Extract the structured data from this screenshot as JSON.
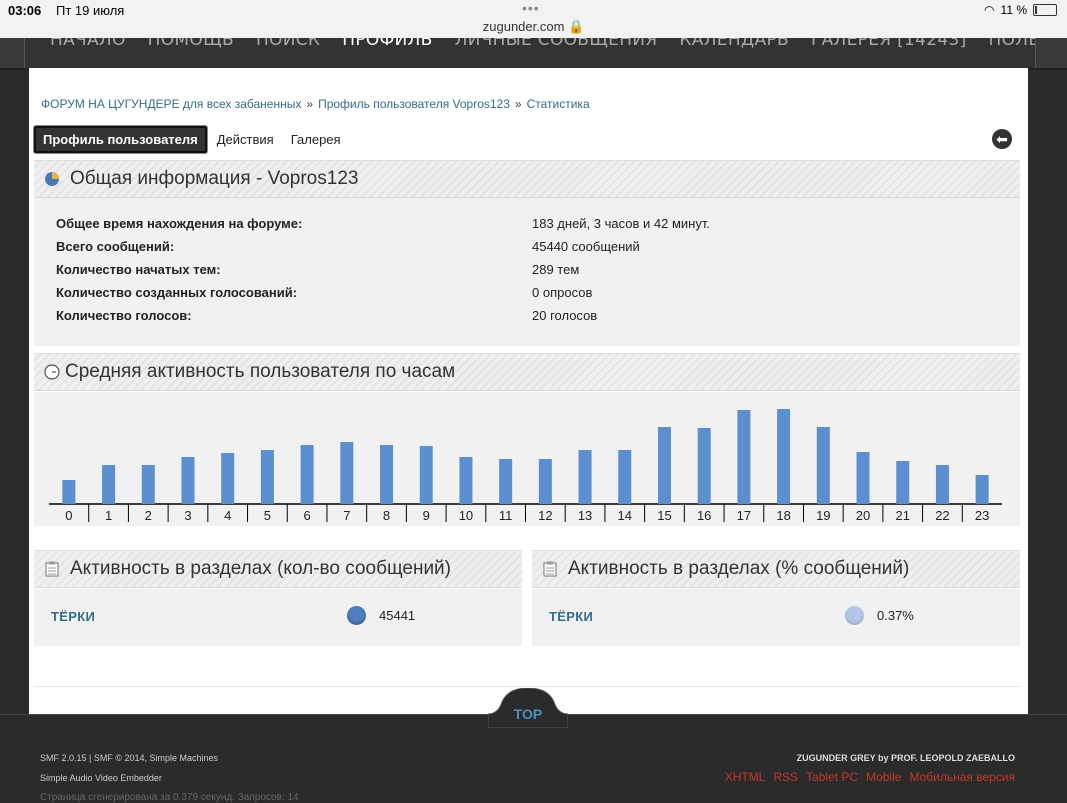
{
  "status": {
    "time": "03:06",
    "date": "Пт 19 июля",
    "url": "zugunder.com",
    "battery": "11 %"
  },
  "nav": [
    "НАЧАЛО",
    "ПОМОЩЬ",
    "ПОИСК",
    "ПРОФИЛЬ",
    "ЛИЧНЫЕ СООБЩЕНИЯ",
    "КАЛЕНДАРЬ",
    "ГАЛЕРЕЯ [14243]",
    "ПОЛЬЗОВАТЕЛИ"
  ],
  "breadcrumb": [
    "ФОРУМ НА ЦУГУНДЕРЕ для всех забаненных",
    "Профиль пользователя Vopros123",
    "Статистика"
  ],
  "tabs": [
    "Профиль пользователя",
    "Действия",
    "Галерея"
  ],
  "general": {
    "title": "Общая информация - Vopros123",
    "rows": [
      {
        "label": "Общее время нахождения на форуме:",
        "value": "183 дней, 3 часов и 42 минут."
      },
      {
        "label": "Всего сообщений:",
        "value": "45440 сообщений"
      },
      {
        "label": "Количество начатых тем:",
        "value": "289 тем"
      },
      {
        "label": "Количество созданных голосований:",
        "value": "0 опросов"
      },
      {
        "label": "Количество голосов:",
        "value": "20 голосов"
      }
    ]
  },
  "activity_title": "Средняя активность пользователя по часам",
  "chart_data": {
    "type": "bar",
    "categories": [
      "0",
      "1",
      "2",
      "3",
      "4",
      "5",
      "6",
      "7",
      "8",
      "9",
      "10",
      "11",
      "12",
      "13",
      "14",
      "15",
      "16",
      "17",
      "18",
      "19",
      "20",
      "21",
      "22",
      "23"
    ],
    "values": [
      24,
      39,
      39,
      47,
      51,
      54,
      59,
      62,
      59,
      58,
      47,
      45,
      45,
      54,
      54,
      77,
      76,
      94,
      95,
      77,
      52,
      43,
      39,
      29
    ],
    "ylim": [
      0,
      100
    ],
    "color": "#5b8fd0"
  },
  "boards_count": {
    "title": "Активность в разделах (кол-во сообщений)",
    "name": "ТЁРКИ",
    "value": "45441",
    "dot_color": "#4f7fbf"
  },
  "boards_pct": {
    "title": "Активность в разделах (% сообщений)",
    "name": "ТЁРКИ",
    "value": "0.37%",
    "dot_color": "#b3c8e6"
  },
  "footer": {
    "top_label": "TOP",
    "left1": "SMF 2.0.15  |  SMF © 2014, Simple Machines",
    "left2": "Simple Audio Video Embedder",
    "left3": "Страница сгенерирована за 0.379 секунд. Запросов: 14",
    "right1": "ZUGUNDER GREY by PROF. LEOPOLD ZAEBALLO",
    "links": [
      "XHTML",
      "RSS",
      "Tablet PC",
      "Mobile",
      "Мобильная версия"
    ]
  }
}
